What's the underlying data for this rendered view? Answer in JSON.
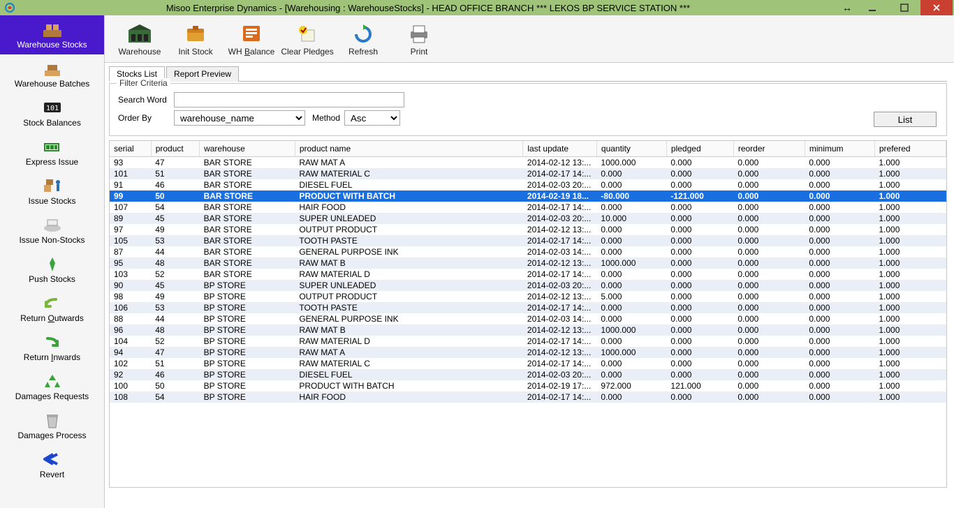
{
  "window": {
    "title": "Misoo Enterprise Dynamics - [Warehousing : WarehouseStocks] - HEAD OFFICE BRANCH *** LEKOS BP SERVICE STATION ***"
  },
  "sidebar": [
    {
      "label": "Warehouse Stocks",
      "icon": "box-shelf"
    },
    {
      "label": "Warehouse Batches",
      "icon": "batches"
    },
    {
      "label": "Stock Balances",
      "icon": "counter"
    },
    {
      "label": "Express Issue",
      "icon": "battery"
    },
    {
      "label": "Issue Stocks",
      "icon": "boxes-person"
    },
    {
      "label": "Issue Non-Stocks",
      "icon": "scanner"
    },
    {
      "label": "Push Stocks",
      "icon": "pin"
    },
    {
      "label": "Return Outwards",
      "icon": "arrow-return-out"
    },
    {
      "label": "Return Inwards",
      "icon": "arrow-return-in"
    },
    {
      "label": "Damages Requests",
      "icon": "recycle"
    },
    {
      "label": "Damages Process",
      "icon": "trash"
    },
    {
      "label": "Revert",
      "icon": "revert"
    }
  ],
  "toolbar": [
    {
      "label": "Warehouse",
      "icon": "warehouse"
    },
    {
      "label": "Init Stock",
      "icon": "init-stock"
    },
    {
      "label": "WH Balance",
      "icon": "wh-balance",
      "raw": "WH <u>B</u>alance"
    },
    {
      "label": "Clear Pledges",
      "icon": "clear-pledges"
    },
    {
      "label": "Refresh",
      "icon": "refresh"
    },
    {
      "label": "Print",
      "icon": "print"
    }
  ],
  "tabs": [
    {
      "label": "Stocks List",
      "active": true
    },
    {
      "label": "Report Preview",
      "active": false
    }
  ],
  "filter": {
    "legend": "Filter Criteria",
    "search_label": "Search Word",
    "search_value": "",
    "orderby_label": "Order By",
    "orderby_value": "warehouse_name",
    "method_label": "Method",
    "method_value": "Asc",
    "list_button": "List"
  },
  "grid": {
    "columns": [
      "serial",
      "product",
      "warehouse",
      "product name",
      "last update",
      "quantity",
      "pledged",
      "reorder",
      "minimum",
      "prefered"
    ],
    "selected_index": 3,
    "rows": [
      [
        "93",
        "47",
        "BAR STORE",
        "RAW MAT A",
        "2014-02-12 13:...",
        "1000.000",
        "0.000",
        "0.000",
        "0.000",
        "1.000"
      ],
      [
        "101",
        "51",
        "BAR STORE",
        "RAW MATERIAL C",
        "2014-02-17 14:...",
        "0.000",
        "0.000",
        "0.000",
        "0.000",
        "1.000"
      ],
      [
        "91",
        "46",
        "BAR STORE",
        "DIESEL FUEL",
        "2014-02-03 20:...",
        "0.000",
        "0.000",
        "0.000",
        "0.000",
        "1.000"
      ],
      [
        "99",
        "50",
        "BAR STORE",
        "PRODUCT WITH BATCH",
        "2014-02-19 18...",
        "-80.000",
        "-121.000",
        "0.000",
        "0.000",
        "1.000"
      ],
      [
        "107",
        "54",
        "BAR STORE",
        "HAIR FOOD",
        "2014-02-17 14:...",
        "0.000",
        "0.000",
        "0.000",
        "0.000",
        "1.000"
      ],
      [
        "89",
        "45",
        "BAR STORE",
        "SUPER UNLEADED",
        "2014-02-03 20:...",
        "10.000",
        "0.000",
        "0.000",
        "0.000",
        "1.000"
      ],
      [
        "97",
        "49",
        "BAR STORE",
        "OUTPUT PRODUCT",
        "2014-02-12 13:...",
        "0.000",
        "0.000",
        "0.000",
        "0.000",
        "1.000"
      ],
      [
        "105",
        "53",
        "BAR STORE",
        "TOOTH PASTE",
        "2014-02-17 14:...",
        "0.000",
        "0.000",
        "0.000",
        "0.000",
        "1.000"
      ],
      [
        "87",
        "44",
        "BAR STORE",
        "GENERAL PURPOSE INK",
        "2014-02-03 14:...",
        "0.000",
        "0.000",
        "0.000",
        "0.000",
        "1.000"
      ],
      [
        "95",
        "48",
        "BAR STORE",
        "RAW MAT B",
        "2014-02-12 13:...",
        "1000.000",
        "0.000",
        "0.000",
        "0.000",
        "1.000"
      ],
      [
        "103",
        "52",
        "BAR STORE",
        "RAW MATERIAL D",
        "2014-02-17 14:...",
        "0.000",
        "0.000",
        "0.000",
        "0.000",
        "1.000"
      ],
      [
        "90",
        "45",
        "BP STORE",
        "SUPER UNLEADED",
        "2014-02-03 20:...",
        "0.000",
        "0.000",
        "0.000",
        "0.000",
        "1.000"
      ],
      [
        "98",
        "49",
        "BP STORE",
        "OUTPUT PRODUCT",
        "2014-02-12 13:...",
        "5.000",
        "0.000",
        "0.000",
        "0.000",
        "1.000"
      ],
      [
        "106",
        "53",
        "BP STORE",
        "TOOTH PASTE",
        "2014-02-17 14:...",
        "0.000",
        "0.000",
        "0.000",
        "0.000",
        "1.000"
      ],
      [
        "88",
        "44",
        "BP STORE",
        "GENERAL PURPOSE INK",
        "2014-02-03 14:...",
        "0.000",
        "0.000",
        "0.000",
        "0.000",
        "1.000"
      ],
      [
        "96",
        "48",
        "BP STORE",
        "RAW MAT B",
        "2014-02-12 13:...",
        "1000.000",
        "0.000",
        "0.000",
        "0.000",
        "1.000"
      ],
      [
        "104",
        "52",
        "BP STORE",
        "RAW MATERIAL D",
        "2014-02-17 14:...",
        "0.000",
        "0.000",
        "0.000",
        "0.000",
        "1.000"
      ],
      [
        "94",
        "47",
        "BP STORE",
        "RAW MAT A",
        "2014-02-12 13:...",
        "1000.000",
        "0.000",
        "0.000",
        "0.000",
        "1.000"
      ],
      [
        "102",
        "51",
        "BP STORE",
        "RAW MATERIAL C",
        "2014-02-17 14:...",
        "0.000",
        "0.000",
        "0.000",
        "0.000",
        "1.000"
      ],
      [
        "92",
        "46",
        "BP STORE",
        "DIESEL FUEL",
        "2014-02-03 20:...",
        "0.000",
        "0.000",
        "0.000",
        "0.000",
        "1.000"
      ],
      [
        "100",
        "50",
        "BP STORE",
        "PRODUCT WITH BATCH",
        "2014-02-19 17:...",
        "972.000",
        "121.000",
        "0.000",
        "0.000",
        "1.000"
      ],
      [
        "108",
        "54",
        "BP STORE",
        "HAIR FOOD",
        "2014-02-17 14:...",
        "0.000",
        "0.000",
        "0.000",
        "0.000",
        "1.000"
      ]
    ]
  }
}
